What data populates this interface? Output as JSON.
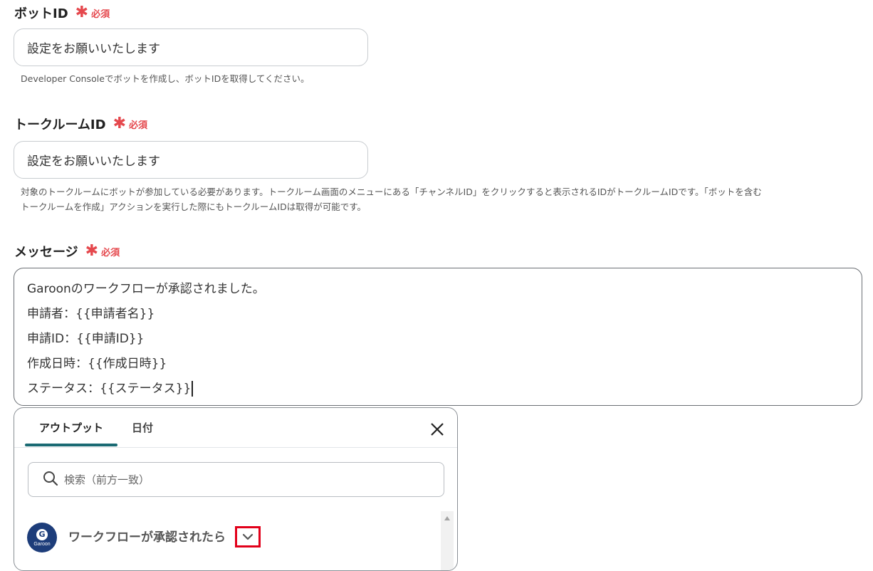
{
  "required_label": "必須",
  "fields": {
    "bot_id": {
      "label": "ボットID",
      "value": "設定をお願いいたします",
      "help": "Developer Consoleでボットを作成し、ボットIDを取得してください。"
    },
    "talkroom_id": {
      "label": "トークルームID",
      "value": "設定をお願いいたします",
      "help_line1": "対象のトークルームにボットが参加している必要があります。トークルーム画面のメニューにある「チャンネルID」をクリックすると表示されるIDがトークルームIDです。「ボットを含む",
      "help_line2": "トークルームを作成」アクションを実行した際にもトークルームIDは取得が可能です。"
    },
    "message": {
      "label": "メッセージ",
      "lines": [
        "Garoonのワークフローが承認されました。",
        "申請者：{{申請者名}}",
        "申請ID：{{申請ID}}",
        "作成日時：{{作成日時}}",
        "ステータス：{{ステータス}}"
      ]
    }
  },
  "output_panel": {
    "tabs": [
      "アウトプット",
      "日付"
    ],
    "active_tab": "アウトプット",
    "search_placeholder": "検索（前方一致）",
    "trigger": {
      "app_name": "Garoon",
      "logo_letter": "G",
      "title": "ワークフローが承認されたら"
    }
  },
  "colors": {
    "required": "#e5484d",
    "tab_accent": "#1a6a73",
    "highlight_box": "#e2001a",
    "garoon_brand": "#1d3d7a"
  }
}
